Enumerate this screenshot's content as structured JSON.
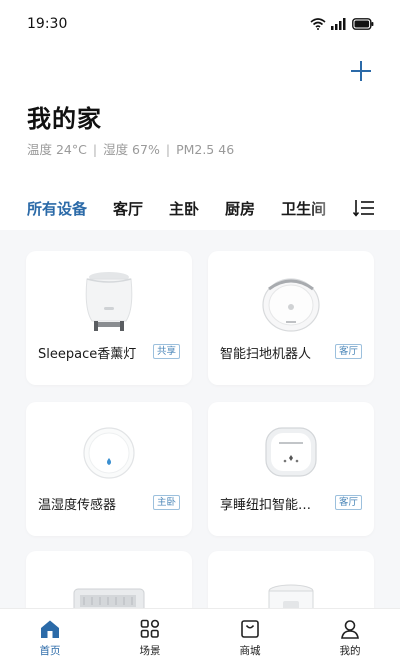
{
  "status_bar": {
    "time": "19:30"
  },
  "header": {
    "title": "我的家",
    "temperature": "温度  24°C",
    "humidity": "湿度 67%",
    "pm25": "PM2.5   46"
  },
  "tabs": [
    "所有设备",
    "客厅",
    "主卧",
    "厨房",
    "卫生间"
  ],
  "active_tab": 0,
  "devices": [
    {
      "name": "Sleepace香薰灯",
      "room": "共享"
    },
    {
      "name": "智能扫地机器人",
      "room": "客厅"
    },
    {
      "name": "温湿度传感器",
      "room": "主卧"
    },
    {
      "name": "享睡纽扣智能…",
      "room": "客厅"
    }
  ],
  "bottom_nav": [
    {
      "label": "首页",
      "icon": "home-icon"
    },
    {
      "label": "场景",
      "icon": "scene-grid-icon"
    },
    {
      "label": "商城",
      "icon": "shop-icon"
    },
    {
      "label": "我的",
      "icon": "profile-icon"
    }
  ],
  "colors": {
    "accent": "#2b6aa8",
    "room_tag": "#4a86b8",
    "background": "#f6f7f9"
  }
}
